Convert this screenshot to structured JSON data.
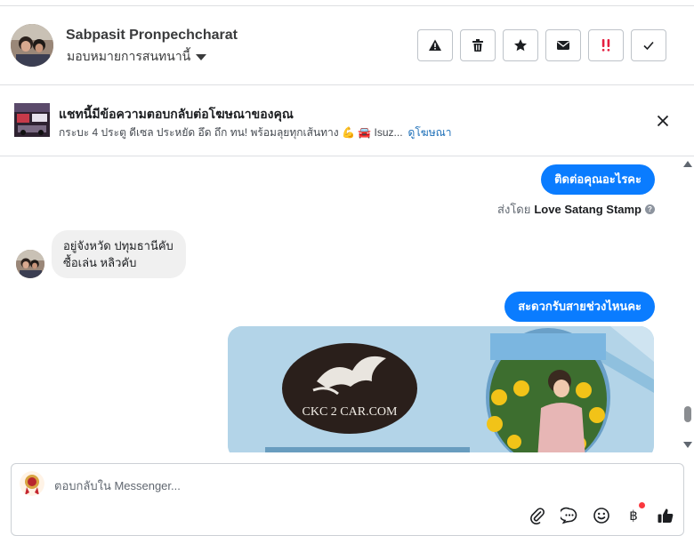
{
  "header": {
    "contact_name": "Sabpasit Pronpechcharat",
    "assign_label": "มอบหมายการสนทนานี้",
    "actions": [
      {
        "name": "report-icon",
        "glyph": "!"
      },
      {
        "name": "trash-icon"
      },
      {
        "name": "star-icon"
      },
      {
        "name": "envelope-icon"
      },
      {
        "name": "follow-up-icon",
        "glyph": "!!"
      },
      {
        "name": "checkmark-icon"
      }
    ]
  },
  "ad_banner": {
    "title": "แชทนี้มีข้อความตอบกลับต่อโฆษณาของคุณ",
    "subtitle": "กระบะ 4 ประตู ดีเซล ประหยัด อึด ถึก ทน! พร้อมลุยทุกเส้นทาง 💪 🚘 Isuz...",
    "link": "ดูโฆษณา"
  },
  "conversation": {
    "msg_out_1": "ติดต่อคุณอะไรคะ",
    "sent_by_prefix": "ส่งโดย",
    "sent_by_name": "Love Satang Stamp",
    "info_glyph": "?",
    "msg_in_line1": "อยู่จังหวัด ปทุมธานีคับ",
    "msg_in_line2": "ซื้อเล่น หลิวคับ",
    "msg_out_2": "สะดวกรับสายช่วงไหนคะ",
    "media_logo_text": "CKC 2 CAR.COM"
  },
  "composer": {
    "placeholder": "ตอบกลับใน Messenger...",
    "tools": [
      "attachment-icon",
      "saved-reply-icon",
      "emoji-icon",
      "payment-icon",
      "thumbs-up-icon"
    ],
    "baht_glyph": "฿"
  },
  "colors": {
    "accent": "#0a7cff",
    "link": "#1d6fb8",
    "follow_up": "#e41e3f"
  }
}
